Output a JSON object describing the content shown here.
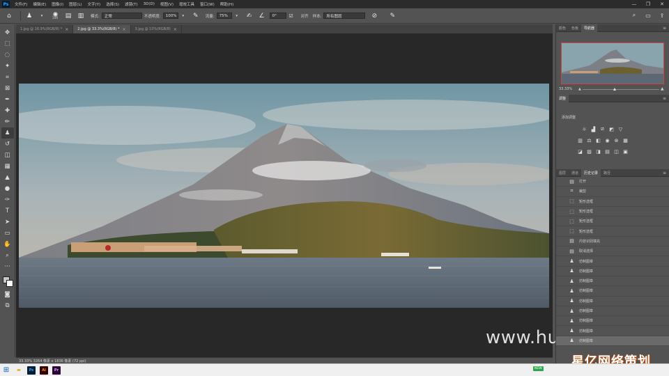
{
  "menubar": {
    "logo": "Ps",
    "items": [
      "文件(F)",
      "编辑(E)",
      "图像(I)",
      "图层(L)",
      "文字(Y)",
      "选择(S)",
      "滤镜(T)",
      "3D(D)",
      "视图(V)",
      "增效工具",
      "窗口(W)",
      "帮助(H)"
    ],
    "minimize": "—",
    "maximize": "❐",
    "close": "✕"
  },
  "options": {
    "brush_size": "100",
    "mode_label": "模式:",
    "mode_value": "正常",
    "opacity_label": "不透明度:",
    "opacity_value": "100%",
    "flow_label": "流量:",
    "flow_value": "75%",
    "angle_value": "0°",
    "align_label": "对齐",
    "sample_label": "样本:",
    "sample_value": "所有图层"
  },
  "tabs": [
    {
      "label": "1.jpg @ 16.9%(RGB/8) *",
      "active": false
    },
    {
      "label": "2.jpg @ 33.3%(RGB/8) *",
      "active": true
    },
    {
      "label": "3.jpg @ 10%(RGB/8)",
      "active": false
    }
  ],
  "status": "33.33%    3264 像素 x 1836 像素 (72 ppi)",
  "watermark": "www.hunls.com",
  "navigator": {
    "tabs": [
      "颜色",
      "色板",
      "导航器"
    ],
    "active_tab": 2,
    "zoom": "33.33%"
  },
  "adjustments": {
    "tabs": [
      "调整"
    ],
    "title": "添加调整"
  },
  "history": {
    "tabs": [
      "图层",
      "通道",
      "历史记录",
      "路径"
    ],
    "active_tab": 2,
    "items": [
      {
        "icon": "doc-icon",
        "label": "打开"
      },
      {
        "icon": "crop-icon",
        "label": "裁剪"
      },
      {
        "icon": "marquee-icon",
        "label": "矩形选框"
      },
      {
        "icon": "marquee-icon",
        "label": "矩形选框"
      },
      {
        "icon": "marquee-icon",
        "label": "矩形选框"
      },
      {
        "icon": "marquee-icon",
        "label": "矩形选框"
      },
      {
        "icon": "doc-icon",
        "label": "内容识别填充"
      },
      {
        "icon": "doc-icon",
        "label": "取消选择"
      },
      {
        "icon": "stamp-icon",
        "label": "仿制图章"
      },
      {
        "icon": "stamp-icon",
        "label": "仿制图章"
      },
      {
        "icon": "stamp-icon",
        "label": "仿制图章"
      },
      {
        "icon": "stamp-icon",
        "label": "仿制图章"
      },
      {
        "icon": "stamp-icon",
        "label": "仿制图章"
      },
      {
        "icon": "stamp-icon",
        "label": "仿制图章"
      },
      {
        "icon": "stamp-icon",
        "label": "仿制图章"
      },
      {
        "icon": "stamp-icon",
        "label": "仿制图章"
      },
      {
        "icon": "stamp-icon",
        "label": "仿制图章"
      }
    ]
  },
  "corner_logo": "星亿网络策划",
  "taskbar_badge": "NEW",
  "colors": {
    "ps_blue": "#31a8ff",
    "panel_bg": "#535353",
    "canvas_bg": "#282828"
  }
}
